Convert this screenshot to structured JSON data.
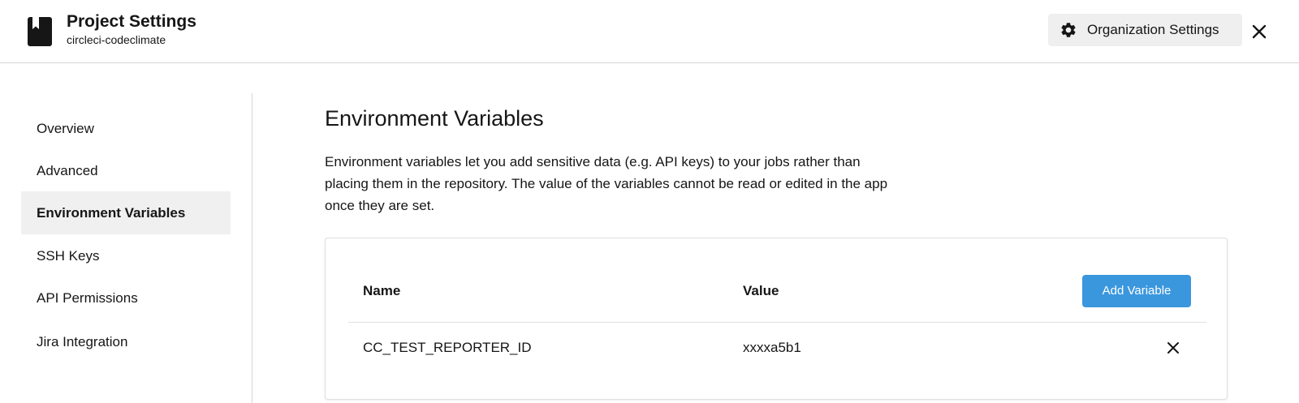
{
  "header": {
    "title": "Project Settings",
    "subtitle": "circleci-codeclimate",
    "project_icon": "bookmark-book-icon",
    "org_settings_label": "Organization Settings",
    "org_settings_icon": "gear-icon",
    "close_icon": "close-icon"
  },
  "sidebar": {
    "items": [
      {
        "label": "Overview",
        "active": false
      },
      {
        "label": "Advanced",
        "active": false
      },
      {
        "label": "Environment Variables",
        "active": true
      },
      {
        "label": "SSH Keys",
        "active": false
      },
      {
        "label": "API Permissions",
        "active": false
      },
      {
        "label": "Jira Integration",
        "active": false
      }
    ]
  },
  "main": {
    "title": "Environment Variables",
    "description": "Environment variables let you add sensitive data (e.g. API keys) to your jobs rather than placing them in the repository. The value of the variables cannot be read or edited in the app once they are set.",
    "table": {
      "columns": [
        "Name",
        "Value"
      ],
      "add_button_label": "Add Variable",
      "rows": [
        {
          "name": "CC_TEST_REPORTER_ID",
          "value": "xxxxa5b1"
        }
      ]
    }
  },
  "colors": {
    "accent": "#3b97dd",
    "active_bg": "#f0f0f0",
    "button_bg": "#efefef"
  }
}
